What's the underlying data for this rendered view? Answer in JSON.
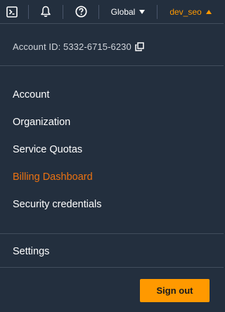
{
  "topbar": {
    "terminal_icon": "cloudshell-terminal-icon",
    "notifications_icon": "bell-icon",
    "help_icon": "help-circle-icon",
    "region_label": "Global",
    "user_label": "dev_seo"
  },
  "account": {
    "id_text": "Account ID: 5332-6715-6230",
    "copy_icon": "copy-icon"
  },
  "menu": {
    "items": [
      {
        "label": "Account"
      },
      {
        "label": "Organization"
      },
      {
        "label": "Service Quotas"
      },
      {
        "label": "Billing Dashboard"
      },
      {
        "label": "Security credentials"
      }
    ],
    "settings_label": "Settings"
  },
  "signout_label": "Sign out",
  "colors": {
    "background": "#232f3e",
    "divider": "#414d5c",
    "accent_orange": "#ff9900",
    "active_link": "#ec7211"
  }
}
